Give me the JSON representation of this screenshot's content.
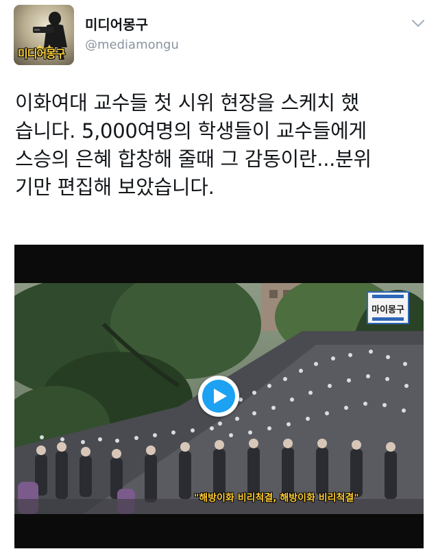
{
  "tweet": {
    "display_name": "미디어몽구",
    "handle": "@mediamongu",
    "avatar_logo": "미디어몽구",
    "text": "이화여대 교수들 첫 시위 현장을 스케치 했\n습니다. 5,000여명의 학생들이 교수들에게\n스승의 은혜 합창해 줄때 그 감동이란...분위\n기만 편집해 보았습니다.",
    "menu_icon": "chevron-down-icon"
  },
  "video": {
    "channel_logo": "마이몽구",
    "subtitle": "\"해방이화 비리척결, 해방이화 비리척결\"",
    "play_icon": "play-icon",
    "accent": "#1da1f2"
  }
}
